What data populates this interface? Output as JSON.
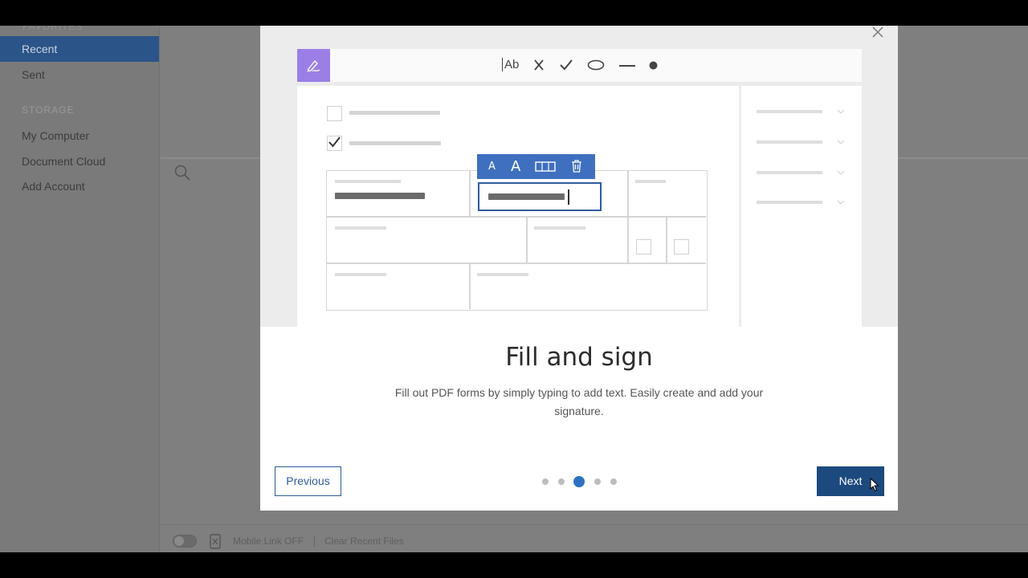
{
  "sidebar": {
    "cut_heading": "FAVORITES",
    "items_top": [
      {
        "label": "Recent",
        "active": true
      },
      {
        "label": "Sent",
        "active": false
      }
    ],
    "storage_heading": "STORAGE",
    "items_storage": [
      {
        "label": "My Computer"
      },
      {
        "label": "Document Cloud"
      },
      {
        "label": "Add Account"
      }
    ]
  },
  "footer": {
    "mobile_link": "Mobile Link OFF",
    "clear_recent": "Clear Recent Files"
  },
  "modal": {
    "title": "Fill and sign",
    "description": "Fill out PDF forms by simply typing to add text. Easily create and add your signature.",
    "previous_label": "Previous",
    "next_label": "Next",
    "pagination": {
      "total": 5,
      "current": 3
    },
    "illustration": {
      "tools": [
        "text-tool",
        "cross-tool",
        "check-tool",
        "ellipse-tool",
        "line-tool",
        "dot-tool"
      ],
      "text_tool_label": "Ab",
      "format_small_a": "A",
      "format_large_a": "A"
    }
  },
  "colors": {
    "accent": "#2e5c9a",
    "next_button": "#1c4a7e",
    "sign_tile": "#9b7fe6",
    "text_toolbar": "#3f6fbf",
    "active_dot": "#2e72c0"
  }
}
